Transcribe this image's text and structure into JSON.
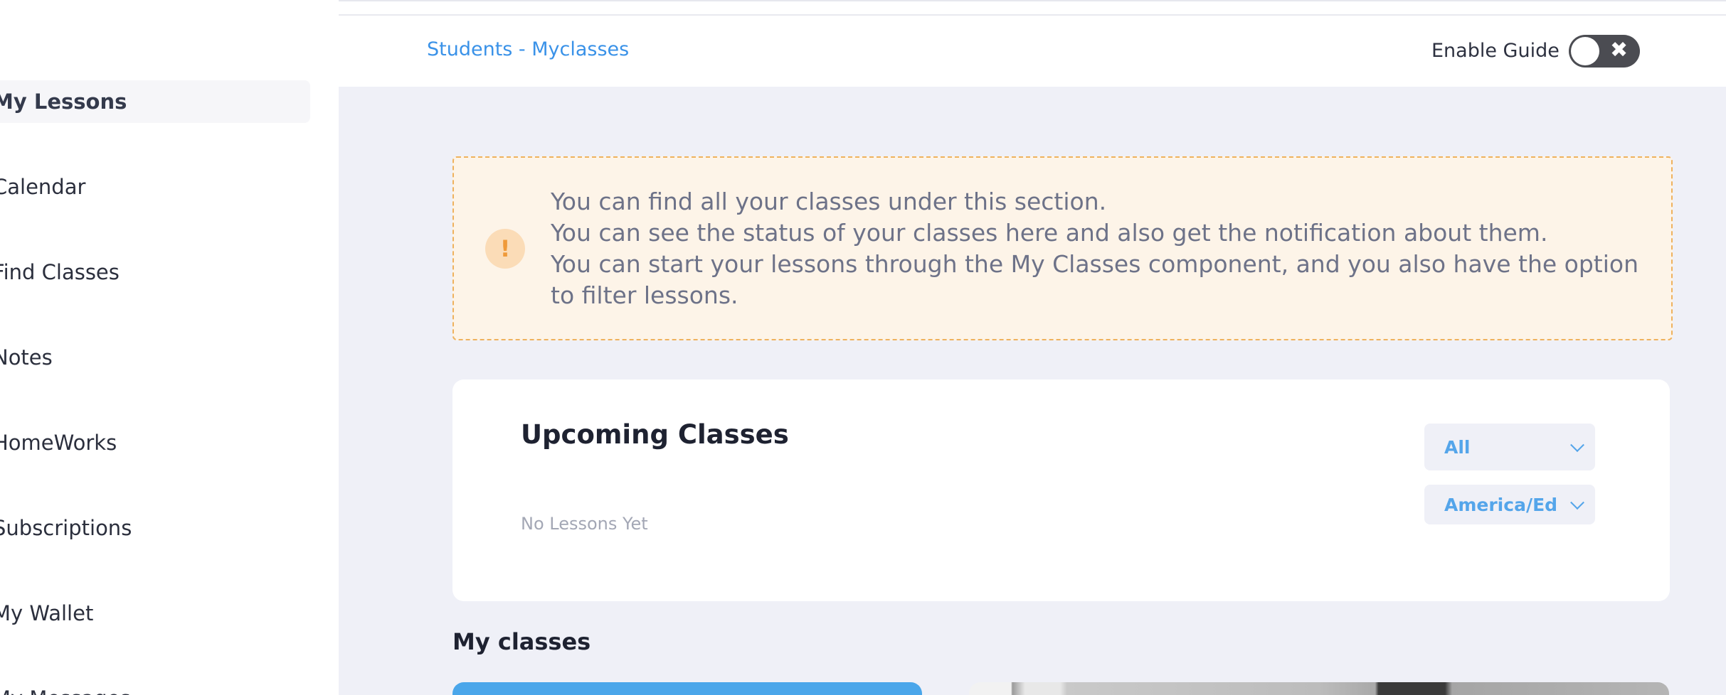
{
  "sidebar": {
    "items": [
      {
        "label": "My Lessons",
        "active": true
      },
      {
        "label": "Calendar"
      },
      {
        "label": "Find Classes"
      },
      {
        "label": "Notes"
      },
      {
        "label": "HomeWorks"
      },
      {
        "label": "Subscriptions"
      },
      {
        "label": "My Wallet"
      },
      {
        "label": "My Messages"
      }
    ]
  },
  "header": {
    "breadcrumb": "Students - Myclasses",
    "guide_label": "Enable Guide",
    "guide_toggle": {
      "enabled": false,
      "icon": "close-icon"
    }
  },
  "alert": {
    "icon": "exclamation-icon",
    "lines": [
      "You can find all your classes under this section.",
      "You can see the status of your classes here and also get the notification about them.",
      "You can start your lessons through the My Classes component, and you also have the option to filter lessons."
    ]
  },
  "upcoming": {
    "title": "Upcoming Classes",
    "empty_text": "No Lessons Yet",
    "filter_value": "All",
    "timezone_value": "America/Edmonton"
  },
  "my_classes": {
    "title": "My classes"
  },
  "colors": {
    "accent": "#3a92e8",
    "main_bg": "#eff0f7",
    "alert_bg": "#fdf4e8",
    "alert_border": "#efb25d",
    "card_blue": "#4aa6ea"
  }
}
